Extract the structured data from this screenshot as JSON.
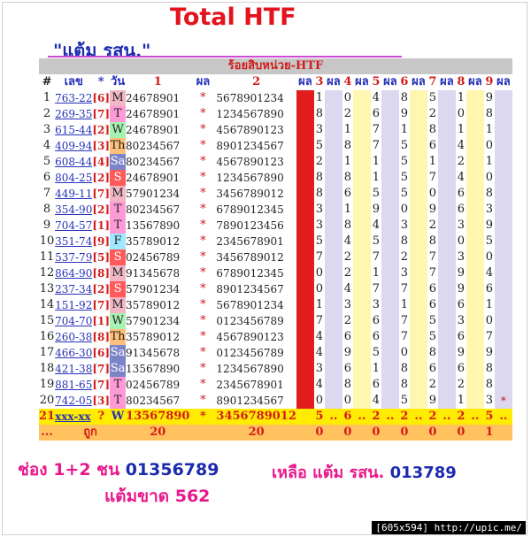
{
  "header": {
    "title": "Total HTF",
    "subtitle": "\"แต้ม รสน.\""
  },
  "table": {
    "caption": "ร้อยสิบหน่วย-HTF",
    "columns": {
      "hash": "#",
      "lek": "เลข",
      "star": "*",
      "wan": "วัน",
      "one": "1",
      "phon1": "ผล",
      "two": "2",
      "phon_red": "ผล",
      "c3": "3",
      "p3": "ผล",
      "c4": "4",
      "p4": "ผล",
      "c5": "5",
      "p5": "ผล",
      "c6": "6",
      "p6": "ผล",
      "c7": "7",
      "p7": "ผล",
      "c8": "8",
      "p8": "ผล",
      "c9": "9",
      "p9": "ผล"
    },
    "rows": [
      {
        "n": "1",
        "lek": "763-22",
        "code": "[6]",
        "day": "M",
        "d1": "24678901",
        "d2": "5678901234",
        "v": [
          "1",
          "0",
          "4",
          "8",
          "5",
          "1",
          "9"
        ],
        "extra": ""
      },
      {
        "n": "2",
        "lek": "269-35",
        "code": "[7]",
        "day": "T",
        "d1": "24678901",
        "d2": "1234567890",
        "v": [
          "8",
          "2",
          "6",
          "9",
          "2",
          "0",
          "8"
        ],
        "extra": ""
      },
      {
        "n": "3",
        "lek": "615-44",
        "code": "[2]",
        "day": "W",
        "d1": "24678901",
        "d2": "4567890123",
        "v": [
          "3",
          "1",
          "7",
          "1",
          "8",
          "1",
          "1"
        ],
        "extra": ""
      },
      {
        "n": "4",
        "lek": "409-94",
        "code": "[3]",
        "day": "Th",
        "d1": "80234567",
        "d2": "8901234567",
        "v": [
          "5",
          "8",
          "7",
          "5",
          "6",
          "4",
          "0"
        ],
        "extra": ""
      },
      {
        "n": "5",
        "lek": "608-44",
        "code": "[4]",
        "day": "Sa",
        "d1": "80234567",
        "d2": "4567890123",
        "v": [
          "2",
          "1",
          "1",
          "5",
          "1",
          "2",
          "1"
        ],
        "extra": ""
      },
      {
        "n": "6",
        "lek": "804-25",
        "code": "[2]",
        "day": "S",
        "d1": "24678901",
        "d2": "1234567890",
        "v": [
          "8",
          "8",
          "1",
          "5",
          "7",
          "4",
          "0"
        ],
        "extra": ""
      },
      {
        "n": "7",
        "lek": "449-11",
        "code": "[7]",
        "day": "M",
        "d1": "57901234",
        "d2": "3456789012",
        "v": [
          "8",
          "6",
          "5",
          "5",
          "0",
          "6",
          "8"
        ],
        "extra": ""
      },
      {
        "n": "8",
        "lek": "354-90",
        "code": "[2]",
        "day": "T",
        "d1": "80234567",
        "d2": "6789012345",
        "v": [
          "3",
          "1",
          "9",
          "0",
          "9",
          "6",
          "3"
        ],
        "extra": ""
      },
      {
        "n": "9",
        "lek": "704-57",
        "code": "[1]",
        "day": "T",
        "d1": "13567890",
        "d2": "7890123456",
        "v": [
          "3",
          "8",
          "4",
          "3",
          "2",
          "3",
          "9"
        ],
        "extra": ""
      },
      {
        "n": "10",
        "lek": "351-74",
        "code": "[9]",
        "day": "F",
        "d1": "35789012",
        "d2": "2345678901",
        "v": [
          "5",
          "4",
          "5",
          "8",
          "8",
          "0",
          "5"
        ],
        "extra": ""
      },
      {
        "n": "11",
        "lek": "537-79",
        "code": "[5]",
        "day": "S",
        "d1": "02456789",
        "d2": "3456789012",
        "v": [
          "7",
          "2",
          "7",
          "2",
          "7",
          "3",
          "0"
        ],
        "extra": ""
      },
      {
        "n": "12",
        "lek": "864-90",
        "code": "[8]",
        "day": "M",
        "d1": "91345678",
        "d2": "6789012345",
        "v": [
          "0",
          "2",
          "1",
          "3",
          "7",
          "9",
          "4"
        ],
        "extra": ""
      },
      {
        "n": "13",
        "lek": "237-34",
        "code": "[2]",
        "day": "S",
        "d1": "57901234",
        "d2": "8901234567",
        "v": [
          "0",
          "4",
          "7",
          "7",
          "6",
          "9",
          "6"
        ],
        "extra": ""
      },
      {
        "n": "14",
        "lek": "151-92",
        "code": "[7]",
        "day": "M",
        "d1": "35789012",
        "d2": "5678901234",
        "v": [
          "1",
          "3",
          "3",
          "1",
          "6",
          "6",
          "1"
        ],
        "extra": ""
      },
      {
        "n": "15",
        "lek": "704-70",
        "code": "[1]",
        "day": "W",
        "d1": "57901234",
        "d2": "0123456789",
        "v": [
          "7",
          "2",
          "6",
          "7",
          "5",
          "3",
          "0"
        ],
        "extra": ""
      },
      {
        "n": "16",
        "lek": "260-38",
        "code": "[8]",
        "day": "Th",
        "d1": "35789012",
        "d2": "4567890123",
        "v": [
          "4",
          "6",
          "6",
          "7",
          "5",
          "6",
          "7"
        ],
        "extra": ""
      },
      {
        "n": "17",
        "lek": "466-30",
        "code": "[6]",
        "day": "Sa",
        "d1": "91345678",
        "d2": "0123456789",
        "v": [
          "4",
          "9",
          "5",
          "0",
          "8",
          "9",
          "9"
        ],
        "extra": ""
      },
      {
        "n": "18",
        "lek": "421-38",
        "code": "[7]",
        "day": "Sa",
        "d1": "13567890",
        "d2": "1234567890",
        "v": [
          "3",
          "6",
          "1",
          "8",
          "6",
          "6",
          "8"
        ],
        "extra": ""
      },
      {
        "n": "19",
        "lek": "881-65",
        "code": "[7]",
        "day": "T",
        "d1": "02456789",
        "d2": "2345678901",
        "v": [
          "4",
          "8",
          "6",
          "8",
          "2",
          "2",
          "8"
        ],
        "extra": ""
      },
      {
        "n": "20",
        "lek": "742-05",
        "code": "[3]",
        "day": "T",
        "d1": "80234567",
        "d2": "8901234567",
        "v": [
          "0",
          "0",
          "4",
          "5",
          "9",
          "1",
          "3"
        ],
        "extra": "*"
      }
    ],
    "row21": {
      "n": "21",
      "lek": "xxx-xx",
      "code": "?",
      "day": "W",
      "d1": "13567890",
      "d2": "3456789012",
      "v": [
        "5",
        "6",
        "2",
        "2",
        "2",
        "2",
        "5"
      ],
      "extra": ""
    },
    "totals": {
      "n": "...",
      "label": "ถูก",
      "t1": "20",
      "t2": "20",
      "v": [
        "0",
        "0",
        "0",
        "0",
        "0",
        "0",
        "1"
      ]
    }
  },
  "footer": {
    "line1_prefix": "ช่อง 1+2 ชน ",
    "line1_value": "01356789",
    "line2_prefix": "แต้มขาด ",
    "line2_value": "562",
    "line3_prefix": "เหลือ แต้ม รสน. ",
    "line3_value": "013789"
  },
  "watermark": "[605x594] http://upic.me/",
  "colors": {
    "title": "#e3141e",
    "subtitle": "#1a2bb0",
    "red_column": "#e11d1d",
    "row21_bg": "#ffec00",
    "totals_bg": "#ffc25e",
    "footer_pink": "#e8188c"
  }
}
